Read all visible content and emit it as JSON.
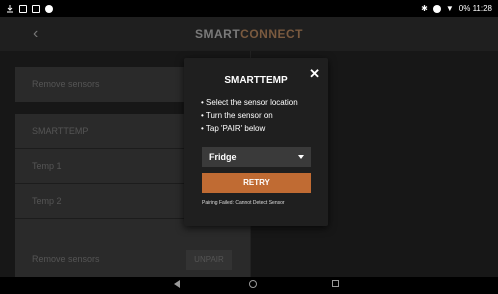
{
  "status_bar": {
    "right_text": "0% 11:28",
    "icons_left": [
      "download-icon",
      "image-icon",
      "cast-icon",
      "circle-icon"
    ],
    "icons_right": [
      "bluetooth-icon",
      "settings-icon",
      "wifi-icon",
      "battery-icon"
    ]
  },
  "header": {
    "back_icon": "chevron-left-icon",
    "brand_part1": "SMART",
    "brand_part2": "CONNECT"
  },
  "background_panel": {
    "rows": [
      {
        "label": "Remove sensors"
      },
      {
        "label": "SMARTTEMP"
      },
      {
        "label": "Temp 1"
      },
      {
        "label": "Temp 2"
      },
      {
        "label": "Remove sensors",
        "action": "UNPAIR"
      }
    ]
  },
  "dialog": {
    "title": "SMARTTEMP",
    "steps": [
      "Select the sensor location",
      "Turn the sensor on",
      "Tap 'PAIR' below"
    ],
    "location_value": "Fridge",
    "retry_label": "RETRY",
    "error_text": "Pairing Failed: Cannot Detect Sensor"
  },
  "colors": {
    "accent": "#c06b33",
    "dialog_bg": "#1f1f1f"
  }
}
